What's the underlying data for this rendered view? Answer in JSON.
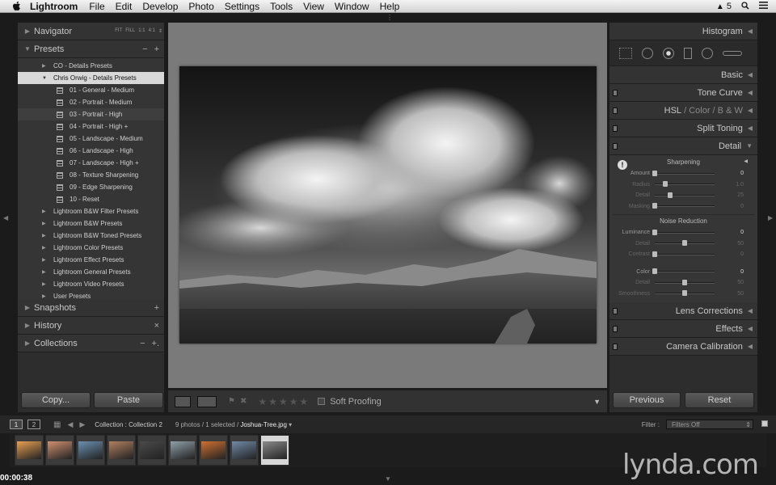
{
  "menubar": {
    "app": "Lightroom",
    "items": [
      "File",
      "Edit",
      "Develop",
      "Photo",
      "Settings",
      "Tools",
      "View",
      "Window",
      "Help"
    ],
    "right": {
      "adobe_badge": "5"
    }
  },
  "left_panel": {
    "navigator": {
      "title": "Navigator",
      "modes": [
        "FIT",
        "FILL",
        "1:1",
        "4:1"
      ]
    },
    "presets": {
      "title": "Presets",
      "actions": [
        "−",
        "+"
      ],
      "items": [
        {
          "label": "CO - Details Presets",
          "type": "folder",
          "expanded": false
        },
        {
          "label": "Chris Orwig - Details Presets",
          "type": "folder",
          "expanded": true,
          "selected": true
        },
        {
          "label": "01 - General - Medium",
          "type": "preset"
        },
        {
          "label": "02 - Portrait - Medium",
          "type": "preset"
        },
        {
          "label": "03 - Portrait - High",
          "type": "preset",
          "hover": true
        },
        {
          "label": "04 - Portrait - High +",
          "type": "preset"
        },
        {
          "label": "05 - Landscape - Medium",
          "type": "preset"
        },
        {
          "label": "06 - Landscape - High",
          "type": "preset"
        },
        {
          "label": "07 - Landscape - High +",
          "type": "preset"
        },
        {
          "label": "08 - Texture Sharpening",
          "type": "preset"
        },
        {
          "label": "09 - Edge Sharpening",
          "type": "preset"
        },
        {
          "label": "10 - Reset",
          "type": "preset"
        },
        {
          "label": "Lightroom B&W Filter Presets",
          "type": "folder",
          "expanded": false
        },
        {
          "label": "Lightroom B&W Presets",
          "type": "folder",
          "expanded": false
        },
        {
          "label": "Lightroom B&W Toned Presets",
          "type": "folder",
          "expanded": false
        },
        {
          "label": "Lightroom Color Presets",
          "type": "folder",
          "expanded": false
        },
        {
          "label": "Lightroom Effect Presets",
          "type": "folder",
          "expanded": false
        },
        {
          "label": "Lightroom General Presets",
          "type": "folder",
          "expanded": false
        },
        {
          "label": "Lightroom Video Presets",
          "type": "folder",
          "expanded": false
        },
        {
          "label": "User Presets",
          "type": "folder",
          "expanded": false
        }
      ]
    },
    "snapshots": {
      "title": "Snapshots",
      "action": "+"
    },
    "history": {
      "title": "History",
      "action": "×"
    },
    "collections": {
      "title": "Collections",
      "actions": [
        "−",
        "+."
      ]
    },
    "copy_label": "Copy...",
    "paste_label": "Paste"
  },
  "toolbar": {
    "soft_proofing": "Soft Proofing",
    "stars": 5
  },
  "right_panel": {
    "histogram": "Histogram",
    "sections": {
      "basic": "Basic",
      "tone_curve": "Tone Curve",
      "hsl": "HSL",
      "color": "Color",
      "bw": "B & W",
      "split_toning": "Split Toning",
      "detail": "Detail",
      "lens": "Lens Corrections",
      "effects": "Effects",
      "camera": "Camera Calibration"
    },
    "sharpening": {
      "title": "Sharpening",
      "sliders": [
        {
          "label": "Amount",
          "value": "0",
          "pos": 0.0,
          "dim": false
        },
        {
          "label": "Radius",
          "value": "1.0",
          "pos": 0.17,
          "dim": true
        },
        {
          "label": "Detail",
          "value": "25",
          "pos": 0.25,
          "dim": true
        },
        {
          "label": "Masking",
          "value": "0",
          "pos": 0.0,
          "dim": true
        }
      ]
    },
    "noise": {
      "title": "Noise Reduction",
      "sliders": [
        {
          "label": "Luminance",
          "value": "0",
          "pos": 0.0,
          "dim": false
        },
        {
          "label": "Detail",
          "value": "50",
          "pos": 0.5,
          "dim": true
        },
        {
          "label": "Contrast",
          "value": "0",
          "pos": 0.0,
          "dim": true
        }
      ],
      "color_sliders": [
        {
          "label": "Color",
          "value": "0",
          "pos": 0.0,
          "dim": false
        },
        {
          "label": "Detail",
          "value": "50",
          "pos": 0.5,
          "dim": true
        },
        {
          "label": "Smoothness",
          "value": "50",
          "pos": 0.5,
          "dim": true
        }
      ]
    },
    "previous_label": "Previous",
    "reset_label": "Reset"
  },
  "filmstrip_bar": {
    "monitor1": "1",
    "monitor2": "2",
    "source": "Collection : Collection 2",
    "count_prefix": "9 photos / 1 selected /",
    "filename": "Joshua-Tree.jpg",
    "filter_label": "Filter :",
    "filter_value": "Filters Off"
  },
  "filmstrip": {
    "thumbs": [
      "#e8a050",
      "#d09070",
      "#6a90b0",
      "#b08060",
      "#4a4a4a",
      "#90a0a8",
      "#d07030",
      "#708aa8",
      "#8a8a8a"
    ],
    "selected_index": 8
  },
  "timecode": "00:00:38",
  "watermark": "lynda.com"
}
